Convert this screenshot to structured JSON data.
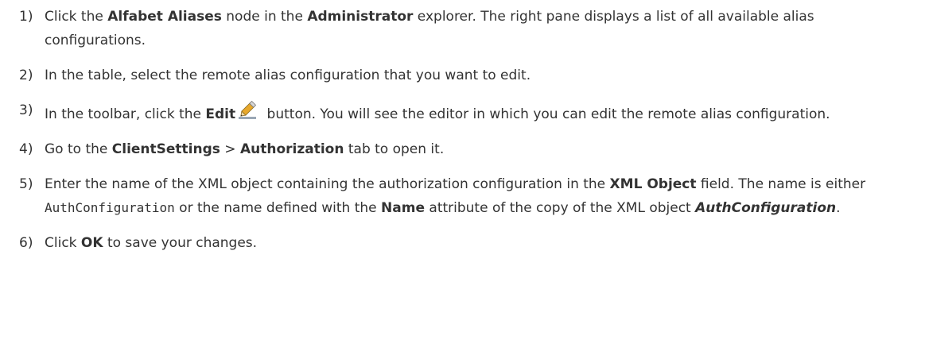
{
  "steps": [
    {
      "num": "1)",
      "t1": "Click the ",
      "b1": "Alfabet Aliases",
      "t2": " node in the ",
      "b2": "Administrator",
      "t3": " explorer. The right pane displays a list of all available alias configurations."
    },
    {
      "num": "2)",
      "t1": "In the table, select the remote alias configuration that you want to edit."
    },
    {
      "num": "3)",
      "t1": "In the toolbar, click the ",
      "b1": "Edit",
      "icon": "pencil-icon",
      "t2": " button. You will see the editor in which you can edit the remote alias configuration."
    },
    {
      "num": "4)",
      "t1": "Go to the ",
      "b1": "ClientSettings",
      "t2": " > ",
      "b2": "Authorization",
      "t3": " tab to open it."
    },
    {
      "num": "5)",
      "t1": "Enter the name of the XML object containing the authorization configuration in the ",
      "b1": "XML Object",
      "t2": " field. The name is either ",
      "code": "AuthConfiguration",
      "t3": " or the name defined with the ",
      "b2": "Name",
      "t4": " attribute of the copy of the XML object ",
      "i1": "AuthConfiguration",
      "t5": "."
    },
    {
      "num": "6)",
      "t1": "Click ",
      "b1": "OK",
      "t2": " to save your changes."
    }
  ]
}
